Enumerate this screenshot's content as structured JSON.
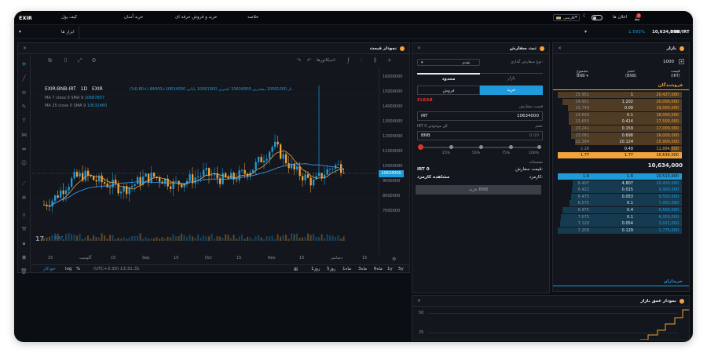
{
  "header": {
    "logo": "EXIR",
    "menu": [
      "کیف پول",
      "خرید آسان",
      "خرید و فروش حرفه ای",
      "خلاصه"
    ],
    "language": "فارسی",
    "notifications_label": "اعلان ها",
    "notification_count": "3"
  },
  "subbar": {
    "tools_label": "ابزار ها",
    "pair": "BNB/IRT",
    "last_price": "10,634,000",
    "change": "1.593%"
  },
  "chart_panel": {
    "title": "نمودار قیمت",
    "timeframe_indicators": "اندیکاتورها",
    "symbol": "EXIR:BNB-IRT",
    "interval": "1D",
    "exchange": "EXIR",
    "ohlc_text": "باز 10561000 بیشترین 10634000 کمترین 10561000 پایانی 10634000+84000 (+0.80%)",
    "ma7_label": "MA 7 close 0 SMA 9",
    "ma7_value": "10687857",
    "ma25_label": "MA 25 close 0 SMA 9",
    "ma25_value": "10032460",
    "price_axis": [
      "16000000",
      "15000000",
      "14000000",
      "13000000",
      "12000000",
      "11000000",
      "10000000",
      "9000000",
      "8000000",
      "7000000"
    ],
    "current_price_tag": "10634000",
    "time_axis": [
      "15",
      "آگوست",
      "15",
      "Sep",
      "15",
      "Oct",
      "15",
      "Nov",
      "15",
      "دسامبر",
      "15"
    ],
    "volume_tag": "3.47",
    "ranges": [
      "5y",
      "1y",
      "6ماه",
      "3ماه",
      "1ماه",
      "5روز",
      "1روز"
    ],
    "clock": "(UTC+3:30) 13:31:31",
    "scale_options": [
      "%",
      "log",
      "خودکار"
    ]
  },
  "order_panel": {
    "title": "ثبت سفارش",
    "order_type_label": "نوع سفارش گذاری:",
    "order_type_value": "نقدی",
    "tab_market": "بازار",
    "tab_limit": "محدود",
    "buy_label": "خرید",
    "sell_label": "فروش",
    "clear_label": "CLEAR",
    "price_label": "قیمت سفارش",
    "price_currency": "IRT",
    "price_value": "10634000",
    "amount_label": "حجم",
    "balance_label": "IRT 0 کل موجودی",
    "amount_currency": "BNB",
    "amount_value": "0.00",
    "slider_marks": [
      "25%",
      "50%",
      "75%",
      "100%"
    ],
    "summary_title": "نشستانه",
    "order_total_label": "قیمت سفارش:",
    "order_total_value": "IRT 0",
    "fee_label": "کارمزد:",
    "fee_value": "مشاهده کارمزد",
    "submit_label": "خرید BNB"
  },
  "orderbook": {
    "title": "بازار",
    "depth": "1000",
    "col_price": "قیمت",
    "col_price_unit": "(IRT)",
    "col_volume": "حجم",
    "col_volume_unit": "(BNB)",
    "col_total": "مجموع",
    "col_total_unit": "BNB",
    "sellers_label": "فروشندگان",
    "asks": [
      {
        "price": "20,427,000",
        "volume": "1",
        "total": "25.951"
      },
      {
        "price": "20,000,000",
        "volume": "1.202",
        "total": "24.951"
      },
      {
        "price": "19,000,000",
        "volume": "0.09",
        "total": "23.749"
      },
      {
        "price": "18,000,000",
        "volume": "0.1",
        "total": "23.659"
      },
      {
        "price": "17,500,000",
        "volume": "0.414",
        "total": "23.655"
      },
      {
        "price": "17,000,000",
        "volume": "0.159",
        "total": "23.241"
      },
      {
        "price": "16,000,000",
        "volume": "0.698",
        "total": "23.082"
      },
      {
        "price": "15,900,000",
        "volume": "20.124",
        "total": "22.384"
      },
      {
        "price": "11,884,000",
        "volume": "0.49",
        "total": "2.26"
      },
      {
        "price": "10,634,000",
        "volume": "1.77",
        "total": "1.77"
      }
    ],
    "mid_price": "10,634,000",
    "bids": [
      {
        "price": "10,513,000",
        "volume": "1.6",
        "total": "1.6"
      },
      {
        "price": "10,400,000",
        "volume": "4.807",
        "total": "6.407"
      },
      {
        "price": "9,900,000",
        "volume": "0.015",
        "total": "6.422"
      },
      {
        "price": "9,500,000",
        "volume": "0.053",
        "total": "6.475"
      },
      {
        "price": "7,001,000",
        "volume": "0.1",
        "total": "6.575"
      },
      {
        "price": "6,500,000",
        "volume": "0.4",
        "total": "6.975"
      },
      {
        "price": "6,000,000",
        "volume": "0.1",
        "total": "7.075"
      },
      {
        "price": "3,021,000",
        "volume": "0.054",
        "total": "7.129"
      },
      {
        "price": "1,775,000",
        "volume": "0.129",
        "total": "7.258"
      }
    ],
    "buyers_label": "خریداران"
  },
  "depth_panel": {
    "title": "نمودار عمق بازار",
    "ticks": [
      "50",
      "25"
    ]
  },
  "colors": {
    "accent_blue": "#1f9bd9",
    "sell_orange": "#f2a33a",
    "red": "#e0352b"
  }
}
